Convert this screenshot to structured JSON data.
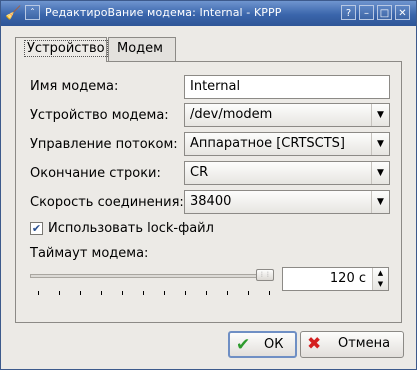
{
  "window": {
    "title": "РедактироВание модема: Internal - KPPP",
    "help_btn": "?",
    "min_btn": "–",
    "max_btn": "□",
    "close_btn": "✕"
  },
  "tabs": [
    {
      "label": "Устройство",
      "active": true
    },
    {
      "label": "Модем",
      "active": false
    }
  ],
  "form": {
    "modem_name_label": "Имя модема:",
    "modem_name_value": "Internal",
    "modem_device_label": "Устройство модема:",
    "modem_device_value": "/dev/modem",
    "flow_control_label": "Управление потоком:",
    "flow_control_value": "Аппаратное [CRTSCTS]",
    "line_end_label": "Окончание строки:",
    "line_end_value": "CR",
    "speed_label": "Скорость соединения:",
    "speed_value": "38400",
    "lockfile_label": "Использовать lock-файл",
    "lockfile_checked": true,
    "timeout_label": "Таймаут модема:",
    "timeout_value": "120 с",
    "timeout_slider_fraction": 1.0
  },
  "buttons": {
    "ok": "ОК",
    "cancel": "Отмена"
  },
  "colors": {
    "titlebar": "#3a65ab",
    "ok_icon": "#2e9b2e",
    "cancel_icon": "#d42020"
  }
}
